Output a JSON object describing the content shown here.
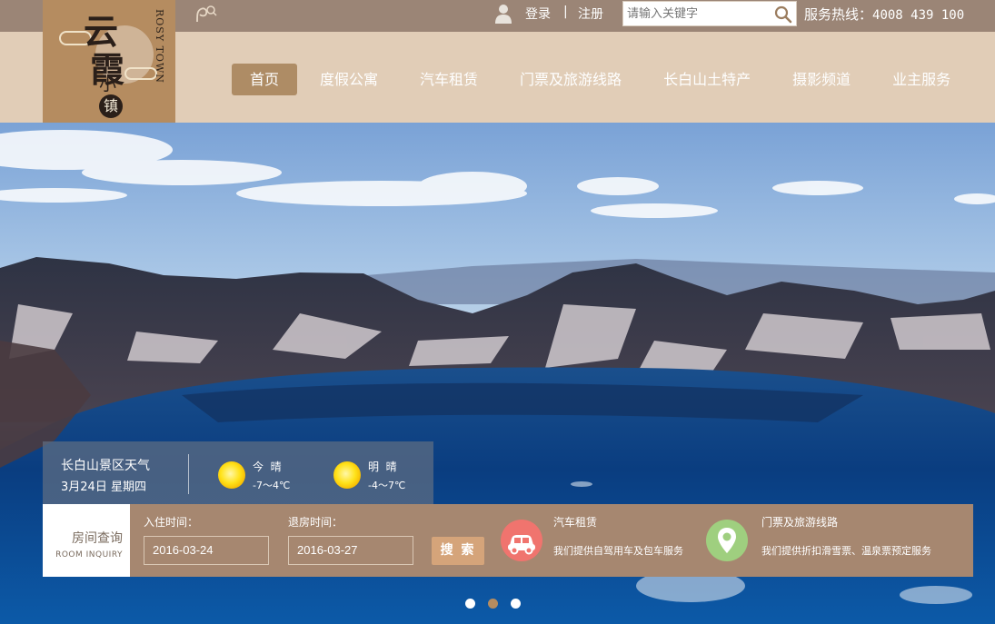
{
  "brand": {
    "logo_text_1": "云",
    "logo_text_2": "霞",
    "logo_small": "小",
    "logo_badge": "镇",
    "logo_en": "ROSY TOWN",
    "color": "#b58c60"
  },
  "header": {
    "login": "登录",
    "separator": "|",
    "register": "注册",
    "search_placeholder": "请输入关键字",
    "hotline_label": "服务热线：",
    "hotline_number": "4008 439 100"
  },
  "nav": {
    "items": [
      {
        "label": "首页",
        "active": true
      },
      {
        "label": "度假公寓"
      },
      {
        "label": "汽车租赁"
      },
      {
        "label": "门票及旅游线路"
      },
      {
        "label": "长白山土特产"
      },
      {
        "label": "摄影频道"
      },
      {
        "label": "业主服务"
      }
    ]
  },
  "weather": {
    "title": "长白山景区天气",
    "date": "3月24日",
    "weekday": "星期四",
    "today": {
      "day": "今",
      "cond": "晴",
      "temp": "-7～4℃",
      "icon": "sun-icon"
    },
    "tomorrow": {
      "day": "明",
      "cond": "晴",
      "temp": "-4～7℃",
      "icon": "sun-icon"
    }
  },
  "booking": {
    "label_cn": "房间查询",
    "label_en": "ROOM INQUIRY",
    "checkin_label": "入住时间：",
    "checkin_value": "2016-03-24",
    "checkout_label": "退房时间：",
    "checkout_value": "2016-03-27",
    "search_button": "搜 索"
  },
  "services": [
    {
      "title": "汽车租赁",
      "desc": "我们提供自驾用车及包车服务",
      "icon": "car-icon",
      "color": "#f0746e"
    },
    {
      "title": "门票及旅游线路",
      "desc": "我们提供折扣滑雪票、温泉票预定服务",
      "icon": "location-pin-icon",
      "color": "#9fcf7f"
    }
  ],
  "carousel": {
    "count": 3,
    "active_index": 1
  },
  "colors": {
    "topbar": "#9b8576",
    "navbar": "#e1cdb7",
    "active_nav": "#ae8c65",
    "booking_bar": "#a68770"
  }
}
